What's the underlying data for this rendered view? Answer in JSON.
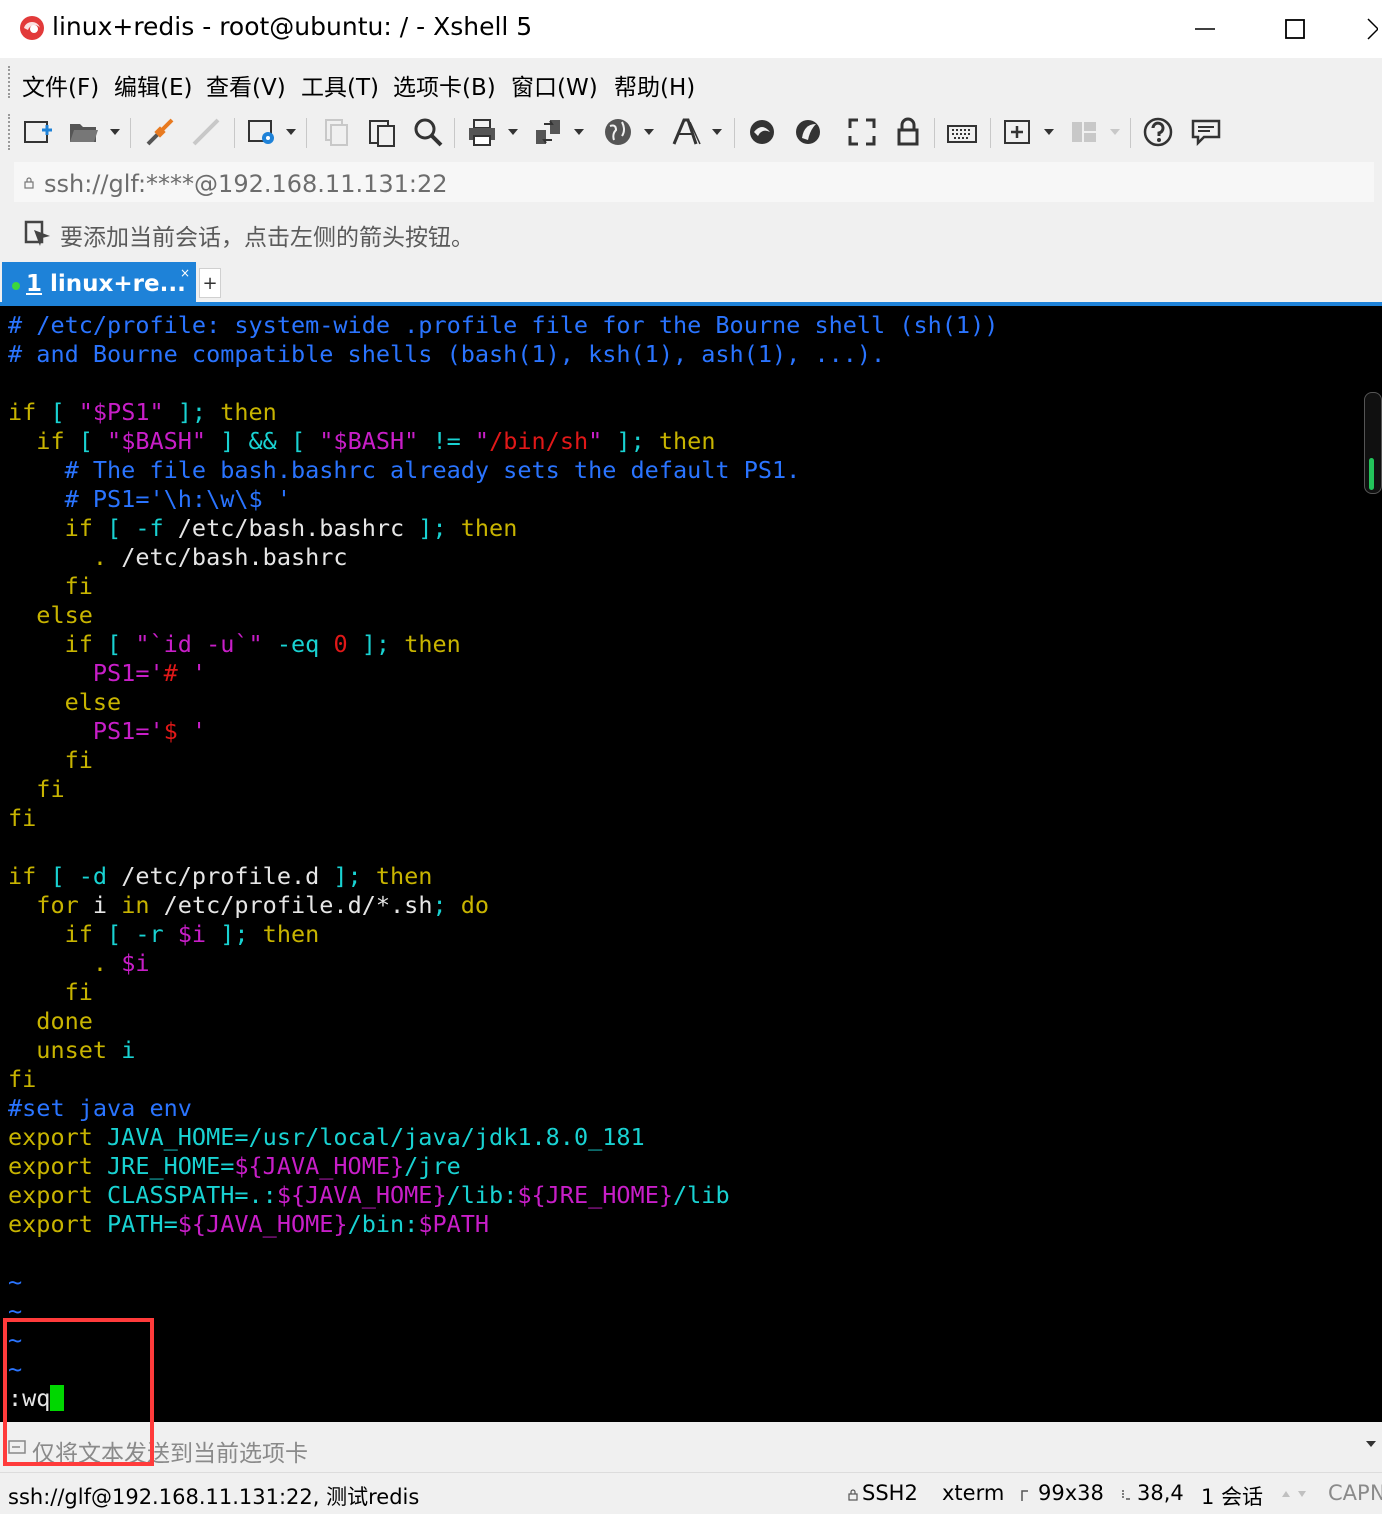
{
  "window": {
    "title": "linux+redis - root@ubuntu: / - Xshell 5",
    "minimize_label": "—",
    "maximize_label": "☐"
  },
  "menu": {
    "items": [
      "文件(F)",
      "编辑(E)",
      "查看(V)",
      "工具(T)",
      "选项卡(B)",
      "窗口(W)",
      "帮助(H)"
    ]
  },
  "toolbar": {
    "icons": [
      "new-session-icon",
      "open-folder-icon",
      "connect-icon",
      "disconnect-icon",
      "session-properties-icon",
      "copy-icon",
      "paste-icon",
      "find-icon",
      "print-icon",
      "transfer-icon",
      "globe-icon",
      "font-icon",
      "xftp-icon",
      "xagent-icon",
      "fullscreen-icon",
      "lock-icon",
      "keyboard-icon",
      "add-tab-icon",
      "layout-icon",
      "help-icon",
      "chat-icon"
    ]
  },
  "address": {
    "value": "ssh://glf:****@192.168.11.131:22"
  },
  "tip": {
    "text": "要添加当前会话，点击左侧的箭头按钮。"
  },
  "tabs": [
    {
      "number": "1",
      "label": "linux+re...",
      "close": "×"
    }
  ],
  "tab_add_label": "+",
  "terminal": {
    "lines": [
      [
        [
          "# /etc/profile: system-wide .profile file for the Bourne shell (sh(1))",
          "blue"
        ]
      ],
      [
        [
          "# and Bourne compatible shells (bash(1), ksh(1), ash(1), ...).",
          "blue"
        ]
      ],
      [],
      [
        [
          "if",
          "yellow"
        ],
        [
          " [ ",
          "cyan"
        ],
        [
          "\"$PS1\"",
          "magenta"
        ],
        [
          " ]; ",
          "cyan"
        ],
        [
          "then",
          "yellow"
        ]
      ],
      [
        [
          "  if",
          "yellow"
        ],
        [
          " [ ",
          "cyan"
        ],
        [
          "\"$BASH\"",
          "magenta"
        ],
        [
          " ] && [ ",
          "cyan"
        ],
        [
          "\"$BASH\"",
          "magenta"
        ],
        [
          " != ",
          "cyan"
        ],
        [
          "\"",
          "magenta"
        ],
        [
          "/bin/sh",
          "red"
        ],
        [
          "\"",
          "magenta"
        ],
        [
          " ]; ",
          "cyan"
        ],
        [
          "then",
          "yellow"
        ]
      ],
      [
        [
          "    # The file bash.bashrc already sets the default PS1.",
          "blue"
        ]
      ],
      [
        [
          "    # PS1='\\h:\\w\\$ '",
          "blue"
        ]
      ],
      [
        [
          "    if",
          "yellow"
        ],
        [
          " [ -f ",
          "cyan"
        ],
        [
          "/etc/bash.bashrc",
          "white"
        ],
        [
          " ]; ",
          "cyan"
        ],
        [
          "then",
          "yellow"
        ]
      ],
      [
        [
          "      . ",
          "yellow"
        ],
        [
          "/etc/bash.bashrc",
          "white"
        ]
      ],
      [
        [
          "    fi",
          "yellow"
        ]
      ],
      [
        [
          "  else",
          "yellow"
        ]
      ],
      [
        [
          "    if",
          "yellow"
        ],
        [
          " [ ",
          "cyan"
        ],
        [
          "\"`",
          "magenta"
        ],
        [
          "id -u",
          "magenta"
        ],
        [
          "`\"",
          "magenta"
        ],
        [
          " -eq ",
          "cyan"
        ],
        [
          "0",
          "red"
        ],
        [
          " ]; ",
          "cyan"
        ],
        [
          "then",
          "yellow"
        ]
      ],
      [
        [
          "      PS1=",
          "magenta"
        ],
        [
          "'",
          "magenta"
        ],
        [
          "# ",
          "red"
        ],
        [
          "'",
          "magenta"
        ]
      ],
      [
        [
          "    else",
          "yellow"
        ]
      ],
      [
        [
          "      PS1=",
          "magenta"
        ],
        [
          "'",
          "magenta"
        ],
        [
          "$ ",
          "red"
        ],
        [
          "'",
          "magenta"
        ]
      ],
      [
        [
          "    fi",
          "yellow"
        ]
      ],
      [
        [
          "  fi",
          "yellow"
        ]
      ],
      [
        [
          "fi",
          "yellow"
        ]
      ],
      [],
      [
        [
          "if",
          "yellow"
        ],
        [
          " [ -d ",
          "cyan"
        ],
        [
          "/etc/profile.d",
          "white"
        ],
        [
          " ]; ",
          "cyan"
        ],
        [
          "then",
          "yellow"
        ]
      ],
      [
        [
          "  for",
          "yellow"
        ],
        [
          " i ",
          "white"
        ],
        [
          "in",
          "yellow"
        ],
        [
          " /etc/profile.d/*.sh",
          "white"
        ],
        [
          "; ",
          "cyan"
        ],
        [
          "do",
          "yellow"
        ]
      ],
      [
        [
          "    if",
          "yellow"
        ],
        [
          " [ -r ",
          "cyan"
        ],
        [
          "$i",
          "magenta"
        ],
        [
          " ]; ",
          "cyan"
        ],
        [
          "then",
          "yellow"
        ]
      ],
      [
        [
          "      . ",
          "yellow"
        ],
        [
          "$i",
          "magenta"
        ]
      ],
      [
        [
          "    fi",
          "yellow"
        ]
      ],
      [
        [
          "  done",
          "yellow"
        ]
      ],
      [
        [
          "  unset",
          "yellow"
        ],
        [
          " i",
          "cyan"
        ]
      ],
      [
        [
          "fi",
          "yellow"
        ]
      ],
      [
        [
          "#set java env",
          "blue"
        ]
      ],
      [
        [
          "export",
          "yellow"
        ],
        [
          " JAVA_HOME=",
          "cyan"
        ],
        [
          "/usr/local/java/jdk1.8.0_181",
          "cyan"
        ]
      ],
      [
        [
          "export",
          "yellow"
        ],
        [
          " JRE_HOME=",
          "cyan"
        ],
        [
          "${JAVA_HOME}",
          "magenta"
        ],
        [
          "/jre",
          "cyan"
        ]
      ],
      [
        [
          "export",
          "yellow"
        ],
        [
          " CLASSPATH=.:",
          "cyan"
        ],
        [
          "${JAVA_HOME}",
          "magenta"
        ],
        [
          "/lib:",
          "cyan"
        ],
        [
          "${JRE_HOME}",
          "magenta"
        ],
        [
          "/lib",
          "cyan"
        ]
      ],
      [
        [
          "export",
          "yellow"
        ],
        [
          " PATH=",
          "cyan"
        ],
        [
          "${JAVA_HOME}",
          "magenta"
        ],
        [
          "/bin:",
          "cyan"
        ],
        [
          "$PATH",
          "magenta"
        ]
      ],
      [],
      [
        [
          "~",
          "blue"
        ]
      ],
      [
        [
          "~",
          "blue"
        ]
      ],
      [
        [
          "~",
          "blue"
        ]
      ],
      [
        [
          "~",
          "blue"
        ]
      ],
      [
        [
          ":wq",
          "white"
        ]
      ]
    ]
  },
  "compose": {
    "placeholder": "仅将文本发送到当前选项卡"
  },
  "status": {
    "connection": "ssh://glf@192.168.11.131:22, 测试redis",
    "protocol": "SSH2",
    "terminal_type": "xterm",
    "size": "99x38",
    "cursor_pos": "38,4",
    "sessions": "1 会话",
    "caps": "CAP",
    "num": "NUM"
  },
  "colors": {
    "blue": "#2a74ff",
    "yellow": "#c8b400",
    "cyan": "#19d2d2",
    "magenta": "#c81ec8",
    "red": "#e01818",
    "white": "#e6e6e6",
    "tab_active": "#1e82d8",
    "cursor": "#00d700",
    "annotation": "#ff3b3b"
  }
}
